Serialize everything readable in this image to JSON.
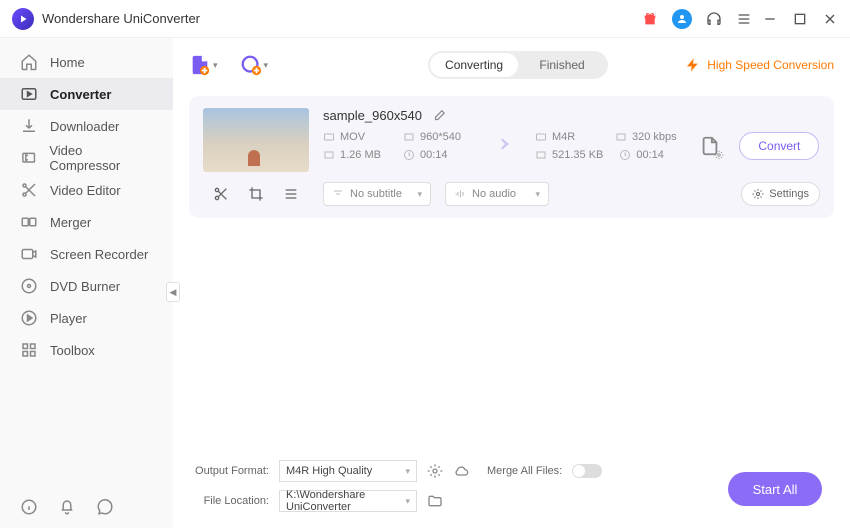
{
  "app": {
    "title": "Wondershare UniConverter"
  },
  "sidebar": {
    "items": [
      {
        "label": "Home"
      },
      {
        "label": "Converter"
      },
      {
        "label": "Downloader"
      },
      {
        "label": "Video Compressor"
      },
      {
        "label": "Video Editor"
      },
      {
        "label": "Merger"
      },
      {
        "label": "Screen Recorder"
      },
      {
        "label": "DVD Burner"
      },
      {
        "label": "Player"
      },
      {
        "label": "Toolbox"
      }
    ]
  },
  "tabs": {
    "converting": "Converting",
    "finished": "Finished"
  },
  "hsc": "High Speed Conversion",
  "file": {
    "name": "sample_960x540",
    "src": {
      "format": "MOV",
      "res": "960*540",
      "size": "1.26 MB",
      "dur": "00:14"
    },
    "dst": {
      "format": "M4R",
      "bitrate": "320 kbps",
      "size": "521.35 KB",
      "dur": "00:14"
    },
    "subtitle_placeholder": "No subtitle",
    "audio_placeholder": "No audio",
    "settings_label": "Settings",
    "convert_label": "Convert"
  },
  "bottom": {
    "output_format_label": "Output Format:",
    "output_format_value": "M4R High Quality",
    "file_location_label": "File Location:",
    "file_location_value": "K:\\Wondershare UniConverter",
    "merge_label": "Merge All Files:",
    "start_all": "Start All"
  }
}
